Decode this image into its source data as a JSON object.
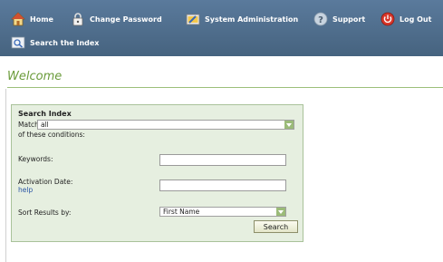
{
  "nav": {
    "home": "Home",
    "change_password": "Change Password",
    "system_administration": "System Administration",
    "support": "Support",
    "log_out": "Log Out",
    "search_index": "Search the Index"
  },
  "page": {
    "title": "Welcome"
  },
  "search_panel": {
    "title": "Search Index",
    "match_label": "Match",
    "match_value": "all",
    "conditions_label": "of these conditions:",
    "keywords_label": "Keywords:",
    "keywords_value": "",
    "activation_date_label": "Activation Date:",
    "help_link": "help",
    "activation_date_value": "",
    "sort_label": "Sort Results by:",
    "sort_value": "First Name",
    "search_button": "Search"
  },
  "colors": {
    "nav_bg": "#4e6d8d",
    "accent_green": "#6a9b3a",
    "panel_bg": "#e6efe0",
    "link": "#2a55a5"
  },
  "icons": [
    "home-icon",
    "lock-icon",
    "tools-icon",
    "question-icon",
    "power-icon",
    "search-index-icon",
    "dropdown-arrow-icon"
  ]
}
